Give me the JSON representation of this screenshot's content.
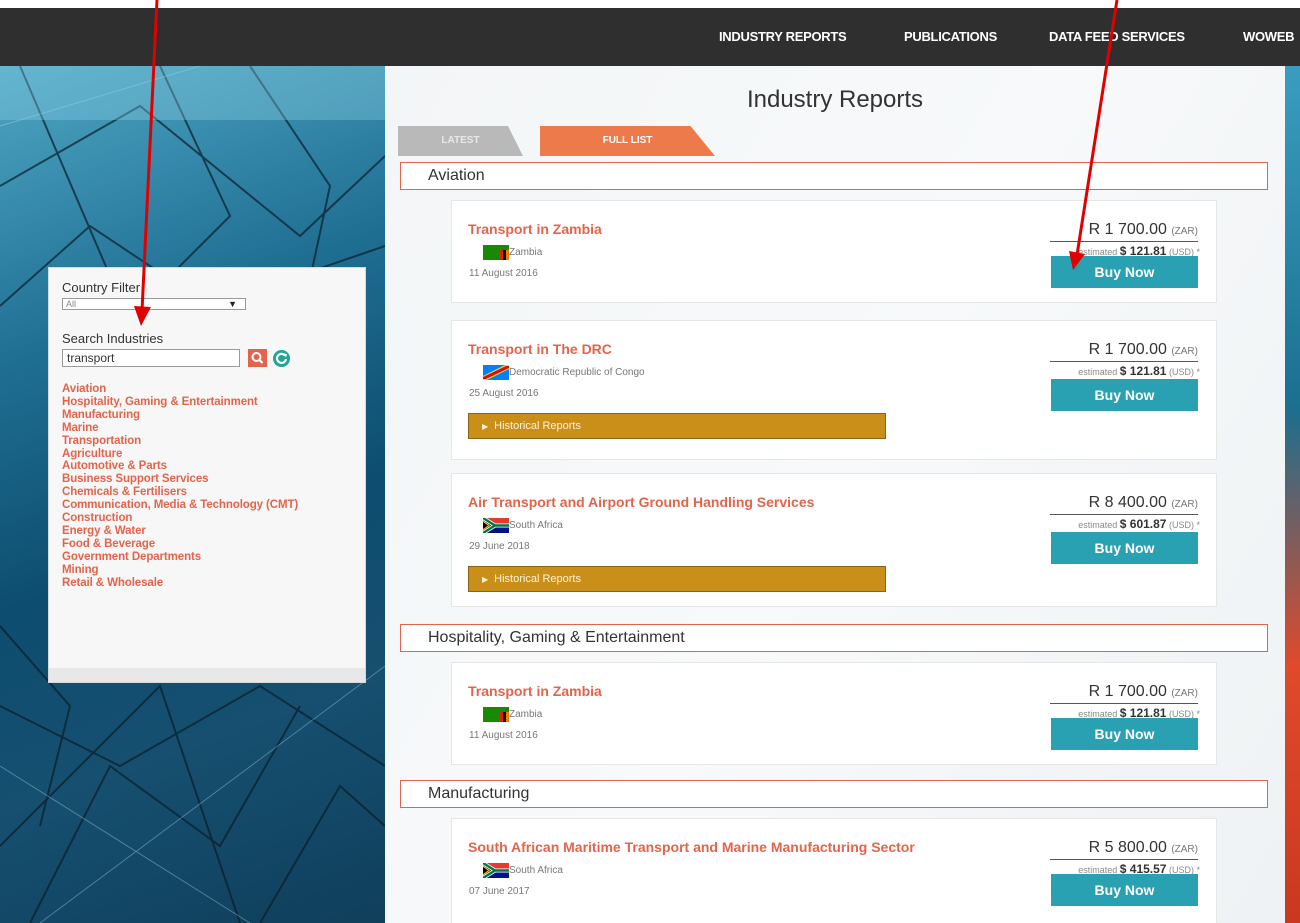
{
  "nav": {
    "items": [
      "INDUSTRY REPORTS",
      "PUBLICATIONS",
      "DATA FEED SERVICES",
      "WOWEB"
    ]
  },
  "page": {
    "title": "Industry Reports",
    "tabs": [
      "LATEST",
      "FULL LIST"
    ],
    "active_tab": "FULL LIST"
  },
  "sidebar": {
    "country_filter_label": "Country Filter",
    "country_selected": "All",
    "search_label": "Search Industries",
    "search_value": "transport",
    "industries": [
      "Aviation",
      "Hospitality, Gaming & Entertainment",
      "Manufacturing",
      "Marine",
      "Transportation",
      "Agriculture",
      "Automotive & Parts",
      "Business Support Services",
      "Chemicals & Fertilisers",
      "Communication, Media & Technology (CMT)",
      "Construction",
      "Energy & Water",
      "Food & Beverage",
      "Government Departments",
      "Mining",
      "Retail & Wholesale"
    ]
  },
  "sections": [
    {
      "category": "Aviation",
      "reports": [
        {
          "title": "Transport in Zambia",
          "country": "Zambia",
          "date": "11 August 2016",
          "price_zar": "R 1 700.00",
          "zar_unit": "(ZAR)",
          "estimated_label": "estimated",
          "price_usd": "$ 121.81",
          "usd_unit": "(USD) *",
          "buy_label": "Buy Now"
        },
        {
          "title": "Transport in The DRC",
          "country": "Democratic Republic of Congo",
          "date": "25 August 2016",
          "price_zar": "R 1 700.00",
          "zar_unit": "(ZAR)",
          "estimated_label": "estimated",
          "price_usd": "$ 121.81",
          "usd_unit": "(USD) *",
          "buy_label": "Buy Now",
          "historical_label": "Historical Reports"
        },
        {
          "title": "Air Transport and Airport Ground Handling Services",
          "country": "South Africa",
          "date": "29 June 2018",
          "price_zar": "R 8 400.00",
          "zar_unit": "(ZAR)",
          "estimated_label": "estimated",
          "price_usd": "$ 601.87",
          "usd_unit": "(USD) *",
          "buy_label": "Buy Now",
          "historical_label": "Historical Reports"
        }
      ]
    },
    {
      "category": "Hospitality, Gaming & Entertainment",
      "reports": [
        {
          "title": "Transport in Zambia",
          "country": "Zambia",
          "date": "11 August 2016",
          "price_zar": "R 1 700.00",
          "zar_unit": "(ZAR)",
          "estimated_label": "estimated",
          "price_usd": "$ 121.81",
          "usd_unit": "(USD) *",
          "buy_label": "Buy Now"
        }
      ]
    },
    {
      "category": "Manufacturing",
      "reports": [
        {
          "title": "South African Maritime Transport and Marine Manufacturing Sector",
          "country": "South Africa",
          "date": "07 June 2017",
          "price_zar": "R 5 800.00",
          "zar_unit": "(ZAR)",
          "estimated_label": "estimated",
          "price_usd": "$ 415.57",
          "usd_unit": "(USD) *",
          "buy_label": "Buy Now"
        }
      ]
    }
  ],
  "colors": {
    "accent": "#e4644b",
    "buy_button": "#2aa0b3",
    "historical_bar": "#c98f18",
    "nav_bg": "#2f2f2f",
    "annotation_arrow": "#e00000"
  }
}
